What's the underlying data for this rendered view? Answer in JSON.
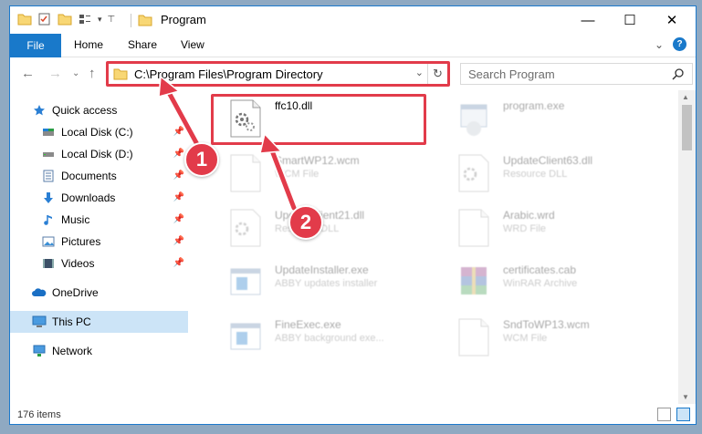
{
  "window": {
    "title": "Program",
    "controls": {
      "minimize": "—",
      "maximize": "☐",
      "close": "✕"
    }
  },
  "ribbon": {
    "tabs": [
      "File",
      "Home",
      "Share",
      "View"
    ],
    "collapse": "⌄",
    "help": "?"
  },
  "nav": {
    "back": "←",
    "forward": "→",
    "recent": "⌄",
    "up": "↑"
  },
  "address": {
    "path": "C:\\Program Files\\Program Directory",
    "dropdown": "⌄",
    "refresh": "↻"
  },
  "search": {
    "placeholder": "Search Program"
  },
  "sidebar": {
    "items": [
      {
        "label": "Quick access",
        "icon": "star-icon",
        "pinned": false
      },
      {
        "label": "Local Disk (C:)",
        "icon": "drive-icon",
        "pinned": true
      },
      {
        "label": "Local Disk (D:)",
        "icon": "drive-icon",
        "pinned": true
      },
      {
        "label": "Documents",
        "icon": "document-icon",
        "pinned": true
      },
      {
        "label": "Downloads",
        "icon": "download-icon",
        "pinned": true
      },
      {
        "label": "Music",
        "icon": "music-icon",
        "pinned": true
      },
      {
        "label": "Pictures",
        "icon": "picture-icon",
        "pinned": true
      },
      {
        "label": "Videos",
        "icon": "video-icon",
        "pinned": true
      },
      {
        "label": "OneDrive",
        "icon": "cloud-icon",
        "pinned": false
      },
      {
        "label": "This PC",
        "icon": "computer-icon",
        "pinned": false,
        "selected": true
      },
      {
        "label": "Network",
        "icon": "network-icon",
        "pinned": false
      }
    ]
  },
  "files": [
    {
      "name": "ffc10.dll",
      "type": "",
      "icon": "dll-gear-icon",
      "highlighted": true
    },
    {
      "name": "program.exe",
      "type": "",
      "icon": "exe-icon",
      "highlighted": false
    },
    {
      "name": "SmartWP12.wcm",
      "type": "WCM File",
      "icon": "blank-file-icon",
      "highlighted": false
    },
    {
      "name": "UpdateClient63.dll",
      "type": "Resource DLL",
      "icon": "dll-gear-icon",
      "highlighted": false
    },
    {
      "name": "UpdateClient21.dll",
      "type": "Resource DLL",
      "icon": "dll-gear-icon",
      "highlighted": false
    },
    {
      "name": "Arabic.wrd",
      "type": "WRD File",
      "icon": "blank-file-icon",
      "highlighted": false
    },
    {
      "name": "UpdateInstaller.exe",
      "type": "ABBY updates installer",
      "icon": "app-window-icon",
      "highlighted": false
    },
    {
      "name": "certificates.cab",
      "type": "WinRAR Archive",
      "icon": "archive-icon",
      "highlighted": false
    },
    {
      "name": "FineExec.exe",
      "type": "ABBY background exe...",
      "icon": "app-window-icon",
      "highlighted": false
    },
    {
      "name": "SndToWP13.wcm",
      "type": "WCM File",
      "icon": "blank-file-icon",
      "highlighted": false
    }
  ],
  "status": {
    "item_count": "176 items"
  },
  "annotations": {
    "step1": "1",
    "step2": "2",
    "color": "#e23b4a"
  },
  "colors": {
    "accent": "#1979ca",
    "selection": "#cce4f7"
  }
}
